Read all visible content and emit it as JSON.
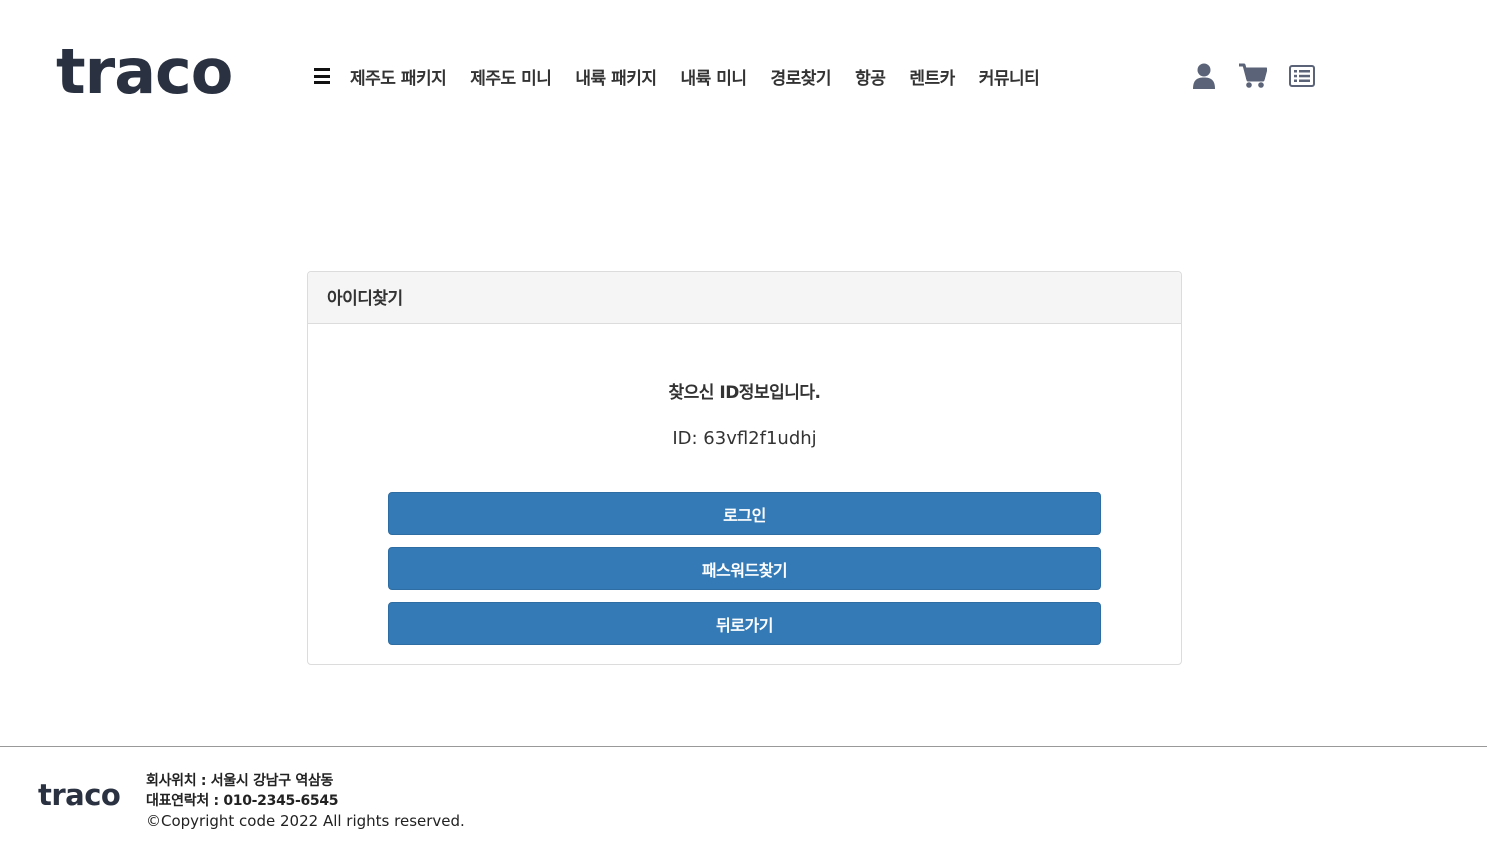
{
  "header": {
    "logo": "traco",
    "nav": [
      "제주도 패키지",
      "제주도 미니",
      "내륙 패키지",
      "내륙 미니",
      "경로찾기",
      "항공",
      "렌트카",
      "커뮤니티"
    ],
    "icons": [
      "user-icon",
      "cart-icon",
      "list-icon"
    ]
  },
  "panel": {
    "title": "아이디찾기",
    "message": "찾으신 ID정보입니다.",
    "id_text": "ID: 63vfl2f1udhj",
    "buttons": {
      "login": "로그인",
      "find_password": "패스워드찾기",
      "back": "뒤로가기"
    },
    "button_color": "#337ab7"
  },
  "footer": {
    "logo": "traco",
    "address": "회사위치 : 서울시 강남구 역삼동",
    "contact": "대표연락처 : 010-2345-6545",
    "copyright": "©Copyright code 2022 All rights reserved."
  },
  "colors": {
    "logo": "#2a3140",
    "icon": "#5a6378"
  }
}
